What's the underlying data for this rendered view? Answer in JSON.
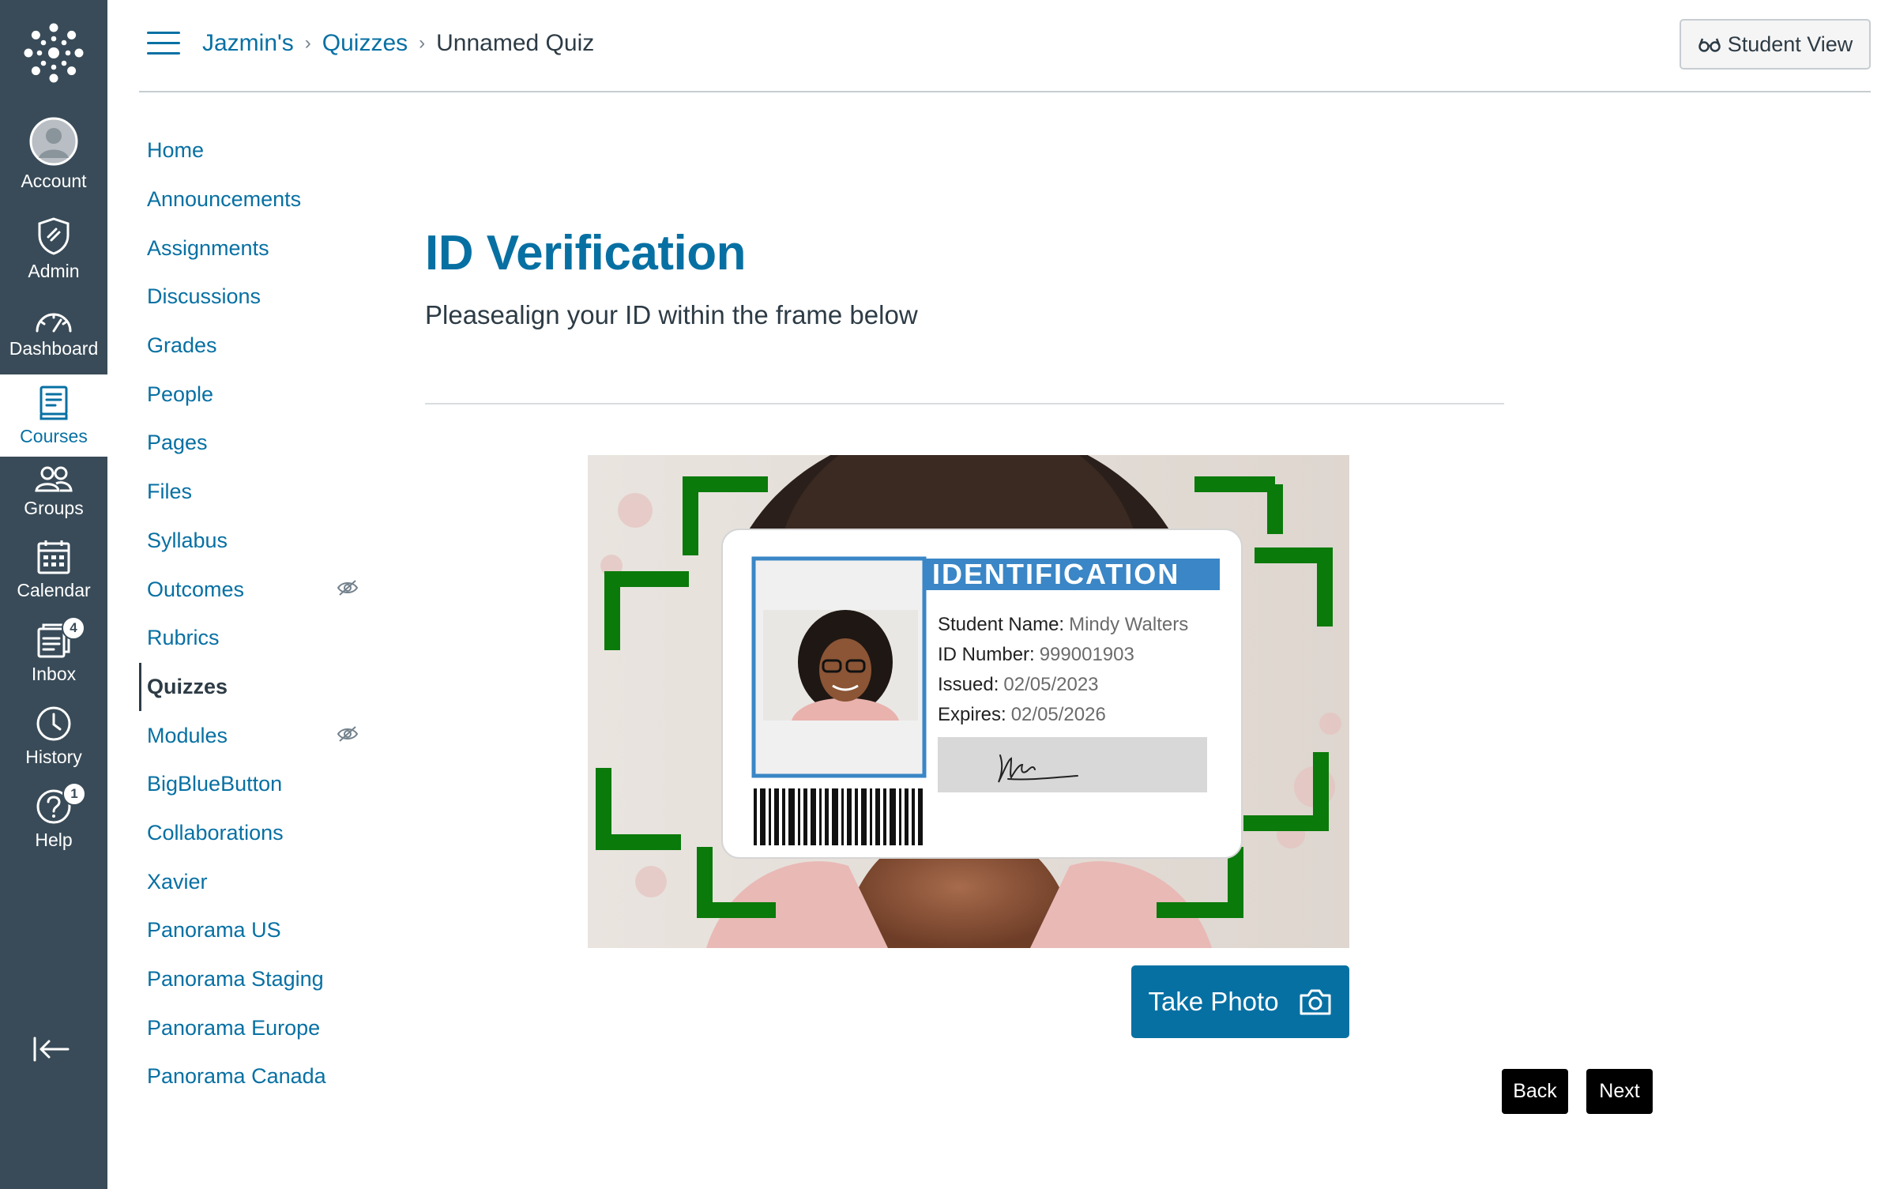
{
  "global_nav": {
    "items": [
      {
        "label": "Account",
        "icon": "avatar-icon"
      },
      {
        "label": "Admin",
        "icon": "shield-icon"
      },
      {
        "label": "Dashboard",
        "icon": "speedometer-icon"
      },
      {
        "label": "Courses",
        "icon": "book-icon"
      },
      {
        "label": "Groups",
        "icon": "groups-icon"
      },
      {
        "label": "Calendar",
        "icon": "calendar-icon"
      },
      {
        "label": "Inbox",
        "icon": "inbox-icon",
        "badge": "4"
      },
      {
        "label": "History",
        "icon": "clock-icon"
      },
      {
        "label": "Help",
        "icon": "help-icon",
        "badge": "1"
      }
    ],
    "active": "Courses"
  },
  "header": {
    "breadcrumbs": [
      "Jazmin's",
      "Quizzes",
      "Unnamed Quiz"
    ],
    "student_view": "Student View"
  },
  "course_nav": {
    "items": [
      "Home",
      "Announcements",
      "Assignments",
      "Discussions",
      "Grades",
      "People",
      "Pages",
      "Files",
      "Syllabus",
      "Outcomes",
      "Rubrics",
      "Quizzes",
      "Modules",
      "BigBlueButton",
      "Collaborations",
      "Xavier",
      "Panorama US",
      "Panorama Staging",
      "Panorama Europe",
      "Panorama Canada"
    ],
    "active": "Quizzes",
    "hidden_items": [
      "Outcomes",
      "Modules"
    ]
  },
  "main": {
    "title": "ID Verification",
    "subtitle": "Pleasealign your ID within the frame below",
    "take_photo": "Take Photo",
    "back": "Back",
    "next": "Next"
  },
  "id_card": {
    "heading": "IDENTIFICATION",
    "fields": [
      {
        "label": "Student Name:",
        "value": "Mindy Walters"
      },
      {
        "label": "ID Number:",
        "value": "999001903"
      },
      {
        "label": "Issued:",
        "value": "02/05/2023"
      },
      {
        "label": "Expires:",
        "value": "02/05/2026"
      }
    ]
  },
  "colors": {
    "nav_bg": "#394b58",
    "link": "#0770a3",
    "frame_green": "#0a7a0a",
    "button_primary": "#0770a3"
  }
}
